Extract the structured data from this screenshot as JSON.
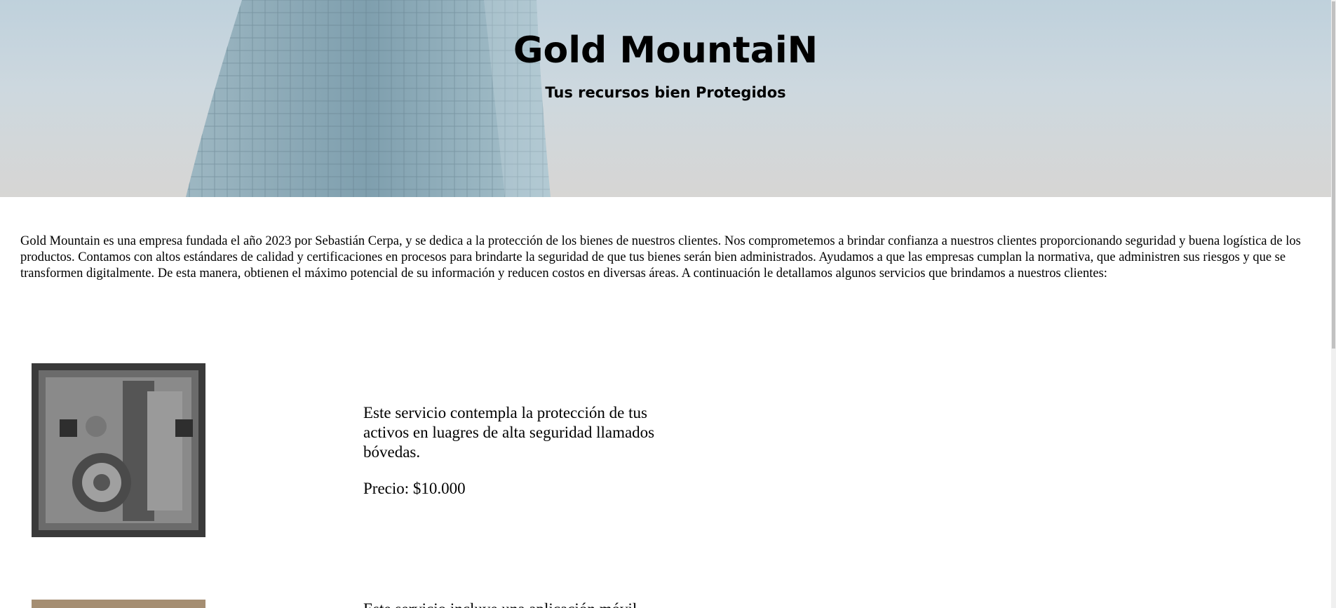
{
  "header": {
    "title": "Gold MountaiN",
    "subtitle": "Tus recursos bien Protegidos"
  },
  "intro": {
    "text": "Gold Mountain es una empresa fundada el año 2023 por Sebastián Cerpa, y se dedica a la protección de los bienes de nuestros clientes. Nos comprometemos a brindar confianza a nuestros clientes proporcionando seguridad y buena logística de los productos. Contamos con altos estándares de calidad y certificaciones en procesos para brindarte la seguridad de que tus bienes serán bien administrados. Ayudamos a que las empresas cumplan la normativa, que administren sus riesgos y que se transformen digitalmente. De esta manera, obtienen el máximo potencial de su información y reducen costos en diversas áreas. A continuación le detallamos algunos servicios que brindamos a nuestros clientes:"
  },
  "services": [
    {
      "description": "Este servicio contempla la protección de tus activos en luagres de alta seguridad llamados bóvedas.",
      "price": "Precio: $10.000",
      "image_icon": "vault-door-icon"
    },
    {
      "description": "Este servicio incluye una aplicación móvil",
      "image_icon": "wood-image-icon"
    }
  ]
}
